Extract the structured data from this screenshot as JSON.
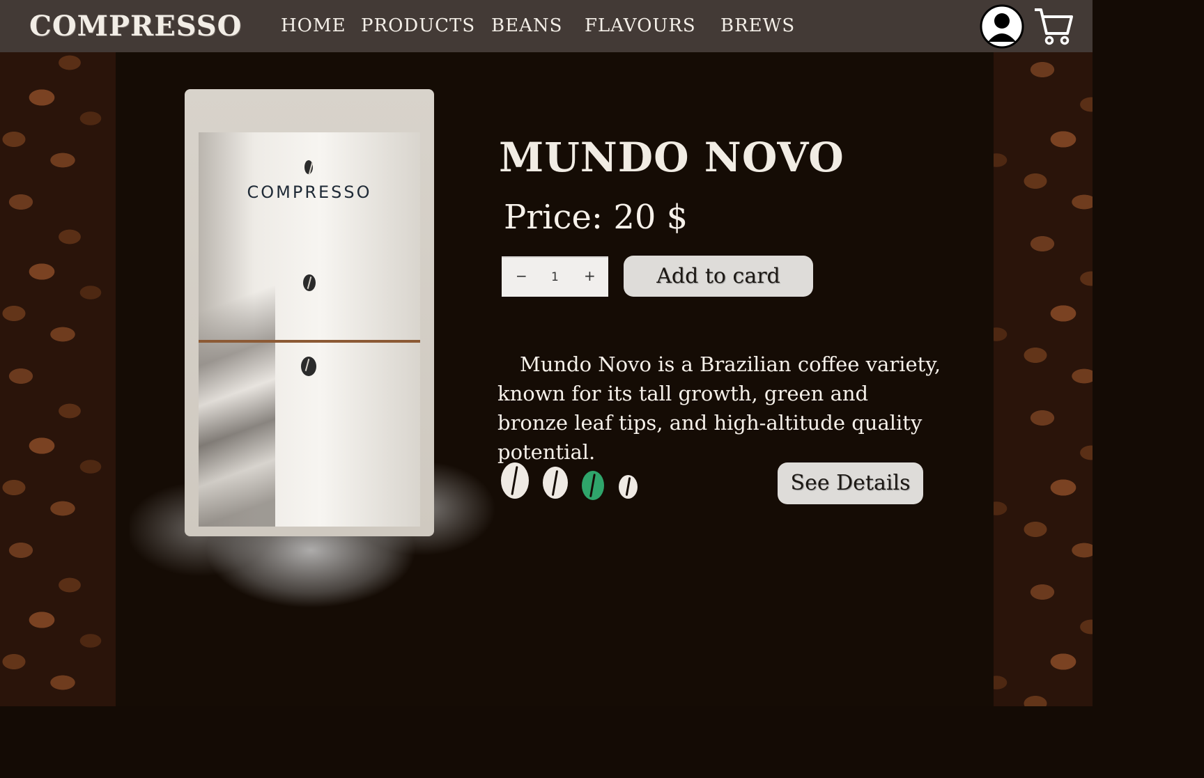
{
  "brand": {
    "logo_text": "COMPRESSO"
  },
  "nav": {
    "items": [
      {
        "label": "HOME"
      },
      {
        "label": "PRODUCTS"
      },
      {
        "label": "BEANS"
      },
      {
        "label": "FLAVOURS"
      },
      {
        "label": "BREWS"
      }
    ]
  },
  "header_icons": {
    "user": "user-account-icon",
    "cart": "shopping-cart-icon"
  },
  "product": {
    "name": "MUNDO NOVO",
    "price_label": "Price: 20 $",
    "quantity": "1",
    "minus_label": "−",
    "plus_label": "+",
    "add_label": "Add to card",
    "description": "Mundo Novo is a Brazilian coffee variety, known for its tall growth, green and bronze leaf tips, and high-altitude quality potential.",
    "details_label": "See Details",
    "bag_brand": "COMPRESSO"
  },
  "roast_beans": [
    {
      "color": "#efeae4"
    },
    {
      "color": "#efeae4"
    },
    {
      "color": "#2fa56b"
    },
    {
      "color": "#efeae4"
    }
  ]
}
